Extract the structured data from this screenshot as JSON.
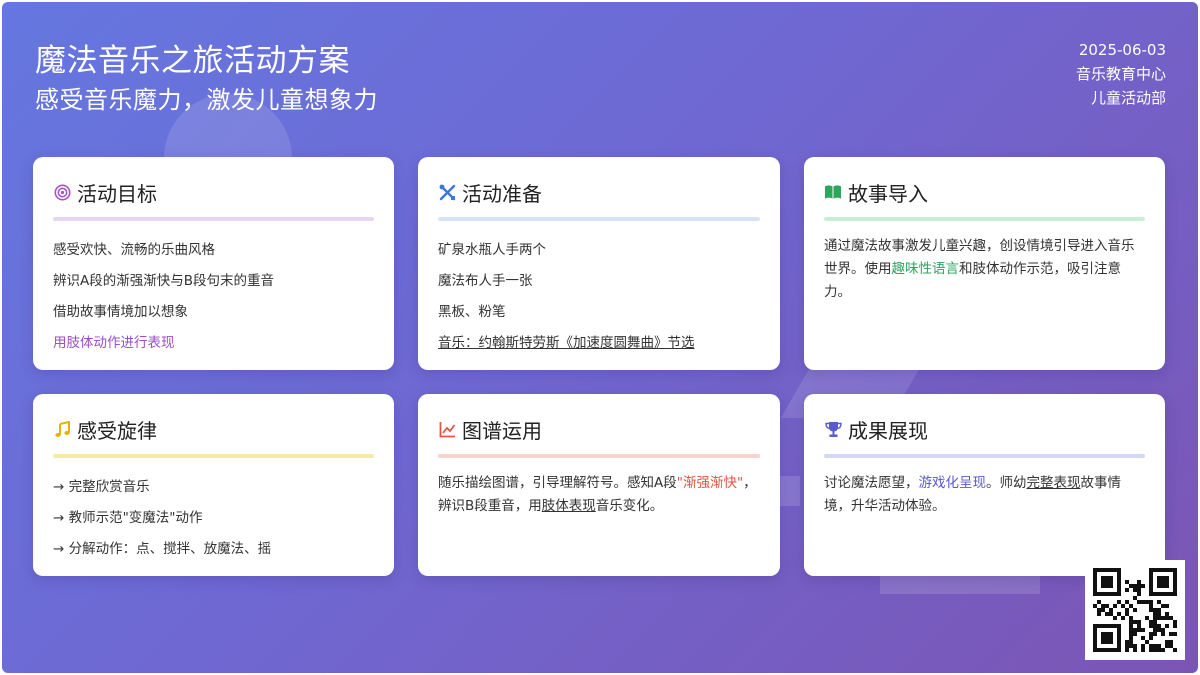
{
  "header": {
    "title": "魔法音乐之旅活动方案",
    "subtitle": "感受音乐魔力，激发儿童想象力",
    "date": "2025-06-03",
    "org": "音乐教育中心",
    "dept": "儿童活动部"
  },
  "cards": {
    "goals": {
      "title": "活动目标",
      "icon": "target-icon",
      "color": "#a855c8",
      "items": [
        "感受欢快、流畅的乐曲风格",
        "辨识A段的渐强渐快与B段句末的重音",
        "借助故事情境加以想象",
        "用肢体动作进行表现"
      ]
    },
    "prep": {
      "title": "活动准备",
      "icon": "tools-icon",
      "color": "#3a78d8",
      "items": [
        "矿泉水瓶人手两个",
        "魔法布人手一张",
        "黑板、粉笔",
        "音乐：约翰斯特劳斯《加速度圆舞曲》节选"
      ]
    },
    "story": {
      "title": "故事导入",
      "icon": "book-icon",
      "color": "#2fa55c",
      "p1": "通过魔法故事激发儿童兴趣，创设情境引导进入音乐世界。使用",
      "p_hl": "趣味性语言",
      "p2": "和肢体动作示范，吸引注意力。"
    },
    "melody": {
      "title": "感受旋律",
      "icon": "music-note-icon",
      "color": "#e5b400",
      "items": [
        "→ 完整欣赏音乐",
        "→ 教师示范\"变魔法\"动作",
        "→ 分解动作：点、搅拌、放魔法、摇"
      ]
    },
    "chart": {
      "title": "图谱运用",
      "icon": "line-chart-icon",
      "color": "#e05545",
      "p1": "随乐描绘图谱，引导理解符号。感知A段",
      "p_hl": "\"渐强渐快\"",
      "p2": "，辨识B段重音，用",
      "p_ul": "肢体表现",
      "p3": "音乐变化。"
    },
    "result": {
      "title": "成果展现",
      "icon": "trophy-icon",
      "color": "#5a5ad0",
      "p1": "讨论魔法愿望，",
      "p_hl": "游戏化呈现",
      "p2": "。师幼",
      "p_ul": "完整表现",
      "p3": "故事情境，升华活动体验。"
    }
  }
}
